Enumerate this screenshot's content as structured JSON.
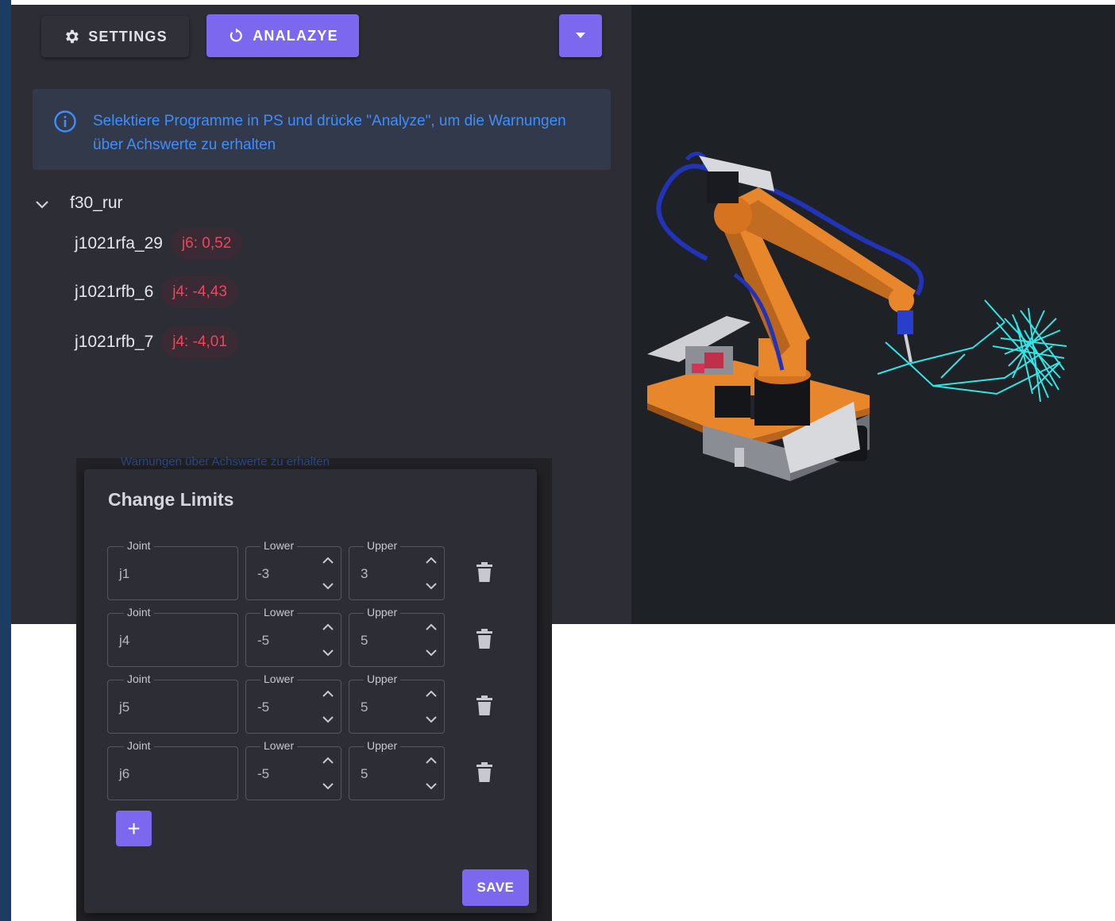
{
  "toolbar": {
    "settings_label": "SETTINGS",
    "analyze_label": "ANALAZYE",
    "settings_icon": "gear-icon",
    "analyze_icon": "refresh-icon",
    "dropdown_icon": "caret-down-icon"
  },
  "info": {
    "icon": "info-circle-icon",
    "text": "Selektiere Programme in PS und drücke \"Analyze\", um die Warnungen über Achswerte zu erhalten"
  },
  "tree": {
    "root_label": "f30_rur",
    "items": [
      {
        "label": "j1021rfa_29",
        "badge": "j6: 0,52"
      },
      {
        "label": "j1021rfb_6",
        "badge": "j4: -4,43"
      },
      {
        "label": "j1021rfb_7",
        "badge": "j4: -4,01"
      }
    ]
  },
  "ghost_text": "Warnungen über Achswerte zu erhalten",
  "dialog": {
    "title": "Change Limits",
    "joint_label": "Joint",
    "lower_label": "Lower",
    "upper_label": "Upper",
    "rows": [
      {
        "joint": "j1",
        "lower": "-3",
        "upper": "3"
      },
      {
        "joint": "j4",
        "lower": "-5",
        "upper": "5"
      },
      {
        "joint": "j5",
        "lower": "-5",
        "upper": "5"
      },
      {
        "joint": "j6",
        "lower": "-5",
        "upper": "5"
      }
    ],
    "add_label": "+",
    "save_label": "SAVE"
  },
  "colors": {
    "accent": "#7b68ee",
    "panel": "#2d2e35",
    "viewport": "#1e2126",
    "info_text": "#3e8eff",
    "badge_text": "#f0455c",
    "robot_orange": "#e8862c",
    "path_cyan": "#2ee6e6",
    "cable_blue": "#2233b8"
  }
}
